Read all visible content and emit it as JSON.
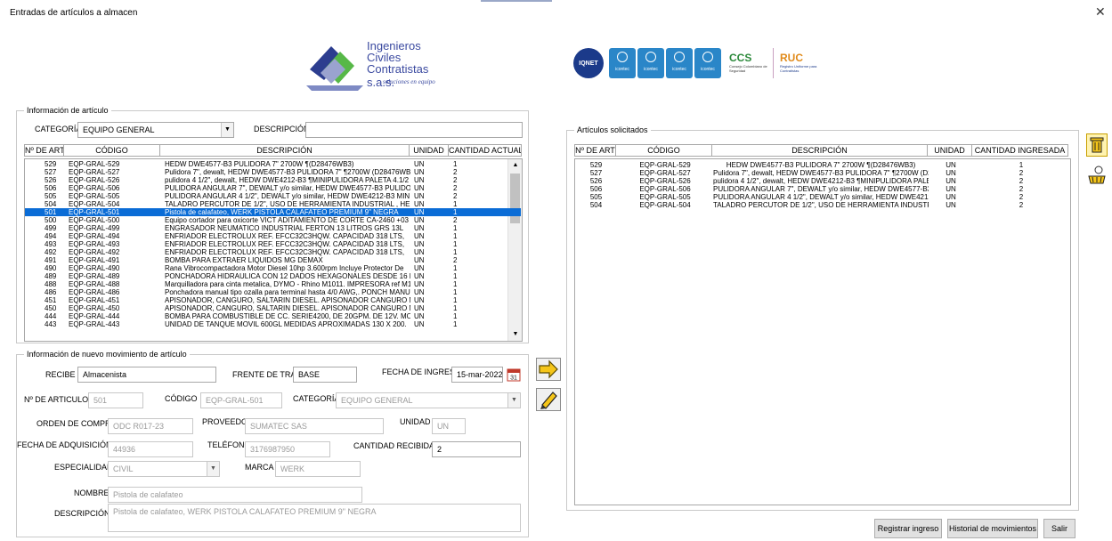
{
  "window": {
    "title": "Entradas de artículos a almacen"
  },
  "logo": {
    "line1": "Ingenieros",
    "line2": "Civiles",
    "line3": "Contratistas s.a.s.",
    "tagline": "soluciones en equipo",
    "brand_color": "#3b4aa0"
  },
  "certifications": {
    "iqnet": "IQNET",
    "icontec": [
      "icontec",
      "icontec",
      "icontec",
      "icontec"
    ],
    "ccs": "CCS",
    "ccs_sub": "Consejo Colombiano de Seguridad",
    "ruc": "RUC",
    "ruc_sub": "Registro Uniforme para Contratistas"
  },
  "info_articulo": {
    "legend": "Información de artículo",
    "categoria_label": "CATEGORÍA",
    "categoria_value": "EQUIPO GENERAL",
    "descripcion_label": "DESCRIPCIÓN",
    "descripcion_value": "",
    "columns": [
      "Nº DE ART",
      "CÓDIGO",
      "DESCRIPCIÓN",
      "UNIDAD",
      "CANTIDAD ACTUAL"
    ],
    "rows": [
      [
        "529",
        "EQP-GRAL-529",
        "HEDW DWE4577-B3 PULIDORA 7\" 2700W ¶(D28476WB3)",
        "UN",
        "1"
      ],
      [
        "527",
        "EQP-GRAL-527",
        "Pulidora 7\", dewalt, HEDW DWE4577-B3 PULIDORA 7\" ¶2700W (D28476WB",
        "UN",
        "2"
      ],
      [
        "526",
        "EQP-GRAL-526",
        "pulidora 4 1/2\", dewalt, HEDW DWE4212-B3 ¶MINIPULIDORA PALETA 4.1/2",
        "UN",
        "2"
      ],
      [
        "506",
        "EQP-GRAL-506",
        "PULIDORA ANGULAR 7\", DEWALT y/o similar, HEDW DWE4577-B3 PULIDOR",
        "UN",
        "2"
      ],
      [
        "505",
        "EQP-GRAL-505",
        "PULIDORA ANGULAR 4 1/2\", DEWALT y/o similar, HEDW DWE4212-B3 MINII",
        "UN",
        "2"
      ],
      [
        "504",
        "EQP-GRAL-504",
        "TALADRO PERCUTOR DE 1/2\", USO DE HERRAMIENTA INDUSTRIAL , HEDW",
        "UN",
        "1"
      ],
      [
        "501",
        "EQP-GRAL-501",
        "Pistola de calafateo, WERK PISTOLA CALAFATEO PREMIUM 9\" NEGRA",
        "UN",
        "1"
      ],
      [
        "500",
        "EQP-GRAL-500",
        "Equipo cortador para oxicorte VICT ADITAMIENTO DE CORTE CA-2460 +03",
        "UN",
        "2"
      ],
      [
        "499",
        "EQP-GRAL-499",
        "ENGRASADOR NEUMATICO INDUSTRIAL FERTON 13 LITROS GRS 13L",
        "UN",
        "1"
      ],
      [
        "494",
        "EQP-GRAL-494",
        "ENFRIADOR ELECTROLUX REF. EFCC32C3HQW. CAPACIDAD 318 LTS,",
        "UN",
        "1"
      ],
      [
        "493",
        "EQP-GRAL-493",
        "ENFRIADOR ELECTROLUX REF. EFCC32C3HQW. CAPACIDAD 318 LTS,",
        "UN",
        "1"
      ],
      [
        "492",
        "EQP-GRAL-492",
        "ENFRIADOR ELECTROLUX REF. EFCC32C3HQW. CAPACIDAD 318 LTS,",
        "UN",
        "1"
      ],
      [
        "491",
        "EQP-GRAL-491",
        "BOMBA PARA EXTRAER LIQUIDOS MG DEMAX",
        "UN",
        "2"
      ],
      [
        "490",
        "EQP-GRAL-490",
        "Rana Vibrocompactadora Motor Diesel 10hp 3.600rpm Incluye Protector De",
        "UN",
        "1"
      ],
      [
        "489",
        "EQP-GRAL-489",
        "PONCHADORA HIDRAULICA CON 12 DADOS HEXAGONALES DESDE 16 MM2",
        "UN",
        "1"
      ],
      [
        "488",
        "EQP-GRAL-488",
        "Marquilladora para cinta metalica, DYMO - Rhino M1011. IMPRESORA ref M1",
        "UN",
        "1"
      ],
      [
        "486",
        "EQP-GRAL-486",
        "Ponchadora manual tipo ozalla para terminal hasta 4/0 AWG,. PONCH MANU",
        "UN",
        "1"
      ],
      [
        "451",
        "EQP-GRAL-451",
        "APISONADOR, CANGURO, SALTARIN DIESEL. APISONADOR CANGURO MR/",
        "UN",
        "1"
      ],
      [
        "450",
        "EQP-GRAL-450",
        "APISONADOR, CANGURO, SALTARIN DIESEL. APISONADOR CANGURO MR/",
        "UN",
        "1"
      ],
      [
        "444",
        "EQP-GRAL-444",
        "BOMBA PARA COMBUSTIBLE DE CC. SERIE4200, DE 20GPM. DE 12V. MOTO",
        "UN",
        "1"
      ],
      [
        "443",
        "EQP-GRAL-443",
        "UNIDAD DE TANQUE MOVIL 600GL MEDIDAS APROXIMADAS 130 X 200.",
        "UN",
        "1"
      ]
    ],
    "selected_index": 6
  },
  "nuevo_movimiento": {
    "legend": "Información de nuevo movimiento de artículo",
    "recibe_label": "RECIBE",
    "recibe_value": "Almacenista",
    "frente_label": "FRENTE DE TRABAJO",
    "frente_value": "BASE",
    "fecha_ingreso_label": "FECHA DE INGRESO",
    "fecha_ingreso_value": "15-mar-2022",
    "articulo_label": "Nº DE ARTICULO",
    "articulo_value": "501",
    "codigo_label": "CÓDIGO",
    "codigo_value": "EQP-GRAL-501",
    "categoria_label": "CATEGORÍA",
    "categoria_value": "EQUIPO GENERAL",
    "orden_label": "ORDEN DE COMPRA",
    "orden_value": "ODC R017-23",
    "proveedor_label": "PROVEEDOR",
    "proveedor_value": "SUMATEC SAS",
    "unidad_label": "UNIDAD",
    "unidad_value": "UN",
    "fecha_adq_label": "FECHA DE ADQUISICIÓN",
    "fecha_adq_value": "44936",
    "telefono_label": "TELÉFONO",
    "telefono_value": "3176987950",
    "cantidad_label": "CANTIDAD RECIBIDA",
    "cantidad_value": "2",
    "especialidad_label": "ESPECIALIDAD",
    "especialidad_value": "CIVIL",
    "marca_label": "MARCA",
    "marca_value": "WERK",
    "nombre_label": "NOMBRE",
    "nombre_value": "Pistola de calafateo",
    "descripcion_label": "DESCRIPCIÓN",
    "descripcion_value": "Pistola de calafateo, WERK PISTOLA CALAFATEO PREMIUM 9\" NEGRA"
  },
  "solicitados": {
    "legend": "Artículos solicitados",
    "columns": [
      "Nº DE ART",
      "CÓDIGO",
      "DESCRIPCIÓN",
      "UNIDAD",
      "CANTIDAD INGRESADA"
    ],
    "rows": [
      [
        "529",
        "EQP-GRAL-529",
        "HEDW DWE4577-B3 PULIDORA 7\" 2700W ¶(D28476WB3)",
        "UN",
        "1"
      ],
      [
        "527",
        "EQP-GRAL-527",
        "Pulidora 7\", dewalt, HEDW DWE4577-B3 PULIDORA 7\" ¶2700W (D28476WB",
        "UN",
        "2"
      ],
      [
        "526",
        "EQP-GRAL-526",
        "pulidora 4 1/2\", dewalt, HEDW DWE4212-B3 ¶MINIPULIDORA PALETA 4.1/2",
        "UN",
        "2"
      ],
      [
        "506",
        "EQP-GRAL-506",
        "PULIDORA ANGULAR 7\", DEWALT y/o similar, HEDW DWE4577-B3 PULIDOR",
        "UN",
        "2"
      ],
      [
        "505",
        "EQP-GRAL-505",
        "PULIDORA ANGULAR 4 1/2\", DEWALT y/o similar, HEDW DWE4212-B3 MINII",
        "UN",
        "2"
      ],
      [
        "504",
        "EQP-GRAL-504",
        "TALADRO PERCUTOR DE 1/2\", USO DE HERRAMIENTA INDUSTRIAL , HEDW",
        "UN",
        "2"
      ]
    ]
  },
  "buttons": {
    "registrar": "Registrar ingreso",
    "historial": "Historial de movimientos",
    "salir": "Salir"
  },
  "icons": {
    "add": "arrow-right-icon",
    "edit": "pencil-icon",
    "delete": "trash-icon",
    "clear": "broom-icon",
    "calendar": "calendar-icon",
    "calendar_day": "31"
  },
  "colors": {
    "selection": "#0a6cd6",
    "accent": "#e8b400"
  }
}
